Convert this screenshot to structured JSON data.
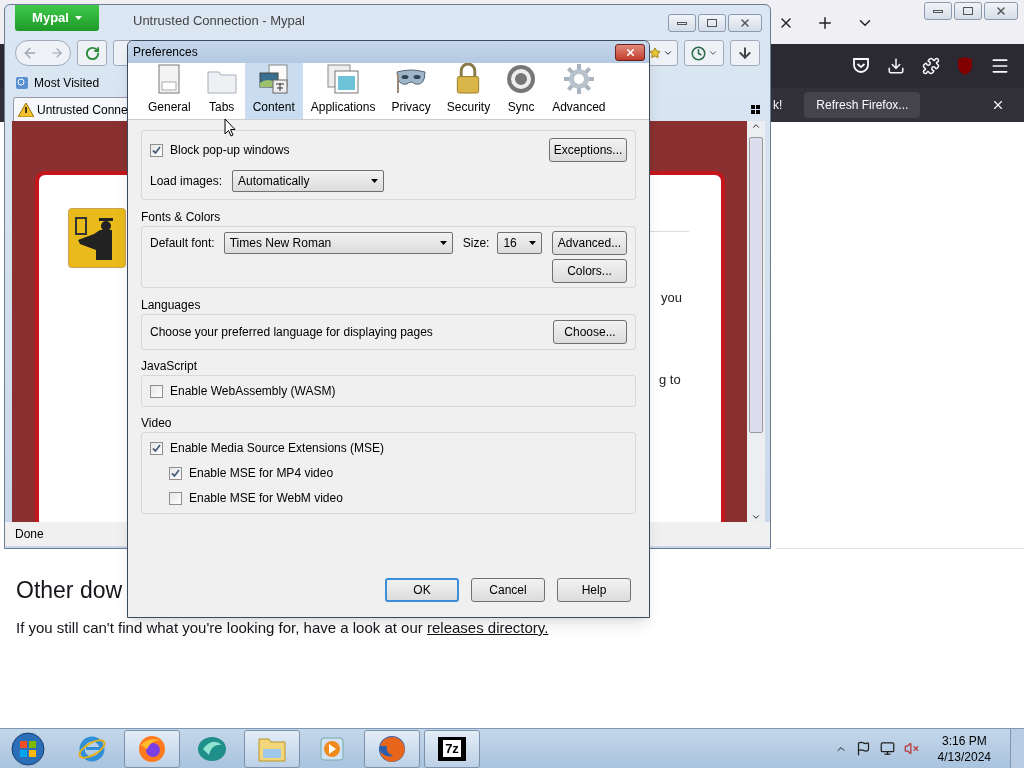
{
  "background_window": {
    "notification": {
      "fragment": "k!",
      "button": "Refresh Firefox..."
    },
    "page": {
      "heading": "Other dow",
      "paragraph": "If you still can't find what you're looking for, have a look at our",
      "link": "releases directory."
    }
  },
  "browser_window": {
    "menu_button": "Mypal",
    "title": "Untrusted Connection - Mypal",
    "bookmarks": [
      "Most Visited"
    ],
    "tabs": [
      {
        "label": "Untrusted Conne",
        "selected": true
      }
    ],
    "page_fragments": [
      "you",
      "g to"
    ],
    "status": "Done"
  },
  "dialog": {
    "title": "Preferences",
    "panes": [
      {
        "label": "General",
        "kind": "general",
        "selected": false
      },
      {
        "label": "Tabs",
        "kind": "tabs",
        "selected": false
      },
      {
        "label": "Content",
        "kind": "content",
        "selected": true
      },
      {
        "label": "Applications",
        "kind": "applications",
        "selected": false
      },
      {
        "label": "Privacy",
        "kind": "privacy",
        "selected": false
      },
      {
        "label": "Security",
        "kind": "security",
        "selected": false
      },
      {
        "label": "Sync",
        "kind": "sync",
        "selected": false
      },
      {
        "label": "Advanced",
        "kind": "advanced",
        "selected": false
      }
    ],
    "popups": {
      "label": "Block pop-up windows",
      "checked": true,
      "button": "Exceptions..."
    },
    "images": {
      "label": "Load images:",
      "value": "Automatically"
    },
    "fonts": {
      "title": "Fonts & Colors",
      "font_label": "Default font:",
      "font_value": "Times New Roman",
      "size_label": "Size:",
      "size_value": "16",
      "buttons": [
        "Advanced...",
        "Colors..."
      ]
    },
    "languages": {
      "title": "Languages",
      "text": "Choose your preferred language for displaying pages",
      "button": "Choose..."
    },
    "javascript": {
      "title": "JavaScript",
      "options": [
        {
          "label": "Enable WebAssembly (WASM)",
          "checked": false
        }
      ]
    },
    "video": {
      "title": "Video",
      "options": [
        {
          "label": "Enable Media Source Extensions (MSE)",
          "checked": true,
          "children": [
            {
              "label": "Enable MSE for MP4 video",
              "checked": true
            },
            {
              "label": "Enable MSE for WebM video",
              "checked": false
            }
          ]
        }
      ]
    },
    "buttons": [
      {
        "label": "OK",
        "default": true
      },
      {
        "label": "Cancel",
        "default": false
      },
      {
        "label": "Help",
        "default": false
      }
    ]
  },
  "taskbar": {
    "apps": [
      {
        "kind": "ie",
        "active": false
      },
      {
        "kind": "firefox-new",
        "active": true
      },
      {
        "kind": "teal",
        "active": false
      },
      {
        "kind": "explorer",
        "active": true
      },
      {
        "kind": "media",
        "active": false
      },
      {
        "kind": "firefox",
        "active": true
      },
      {
        "kind": "archiver",
        "active": true,
        "label": "7z"
      }
    ],
    "clock": {
      "time": "3:16 PM",
      "date": "4/13/2024"
    }
  }
}
